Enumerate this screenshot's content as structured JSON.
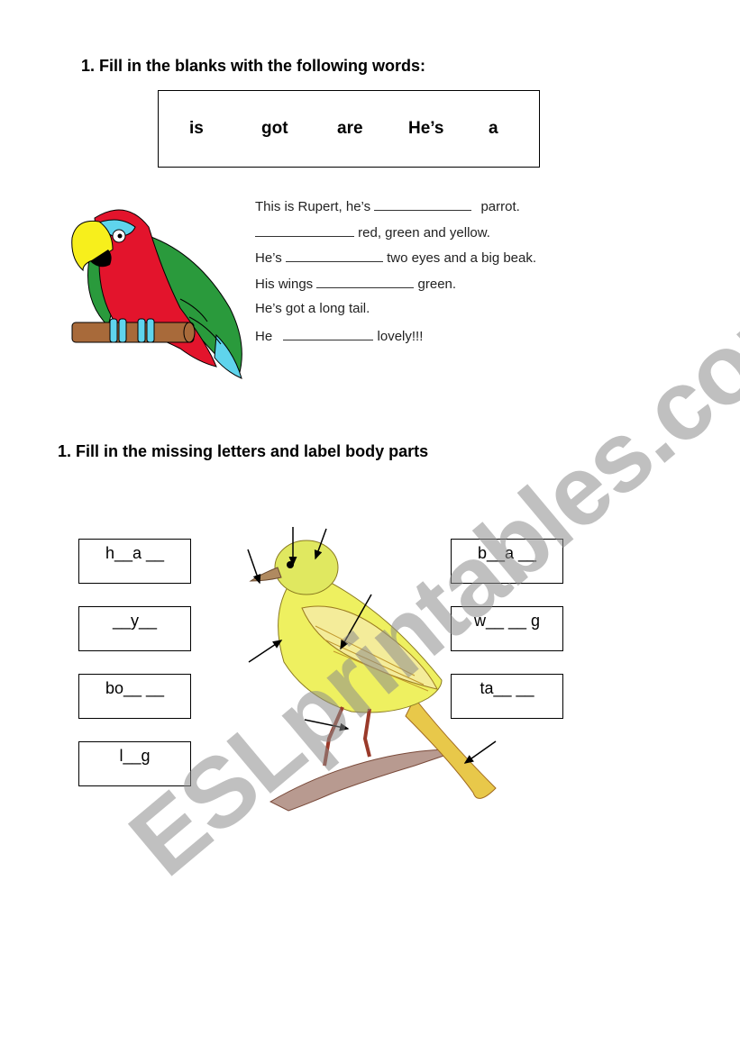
{
  "exercise1": {
    "heading": "1.  Fill in the blanks with the following words:",
    "word_bank": [
      "is",
      "got",
      "are",
      "He’s",
      "a"
    ],
    "sentences": [
      {
        "before": "This is Rupert, he’s",
        "after": "parrot."
      },
      {
        "before": "",
        "after": "red, green and yellow."
      },
      {
        "before": "He’s",
        "after": "two eyes and a big beak."
      },
      {
        "before": "His wings",
        "after": "green."
      },
      {
        "before": "He’s got a long tail.",
        "after": ""
      },
      {
        "before": "He",
        "after": "lovely!!!"
      }
    ],
    "image": "parrot-illustration"
  },
  "exercise2": {
    "heading": "1.   Fill in the missing letters and label body parts",
    "left_labels": [
      "h__a __",
      "__y__",
      "bo__ __",
      "l__g"
    ],
    "right_labels": [
      "b__a __",
      "w__ __ g",
      "ta__ __"
    ],
    "image": "canary-illustration"
  },
  "watermark": "ESLprintables.com",
  "colors": {
    "parrot_red": "#e3142c",
    "parrot_green": "#2a9a3c",
    "parrot_yellow": "#f7ef1c",
    "parrot_cyan": "#5fd4ec",
    "perch_brown": "#a86a3a",
    "canary_yellow": "#eef060",
    "watermark_gray": "#8c8c8c"
  }
}
